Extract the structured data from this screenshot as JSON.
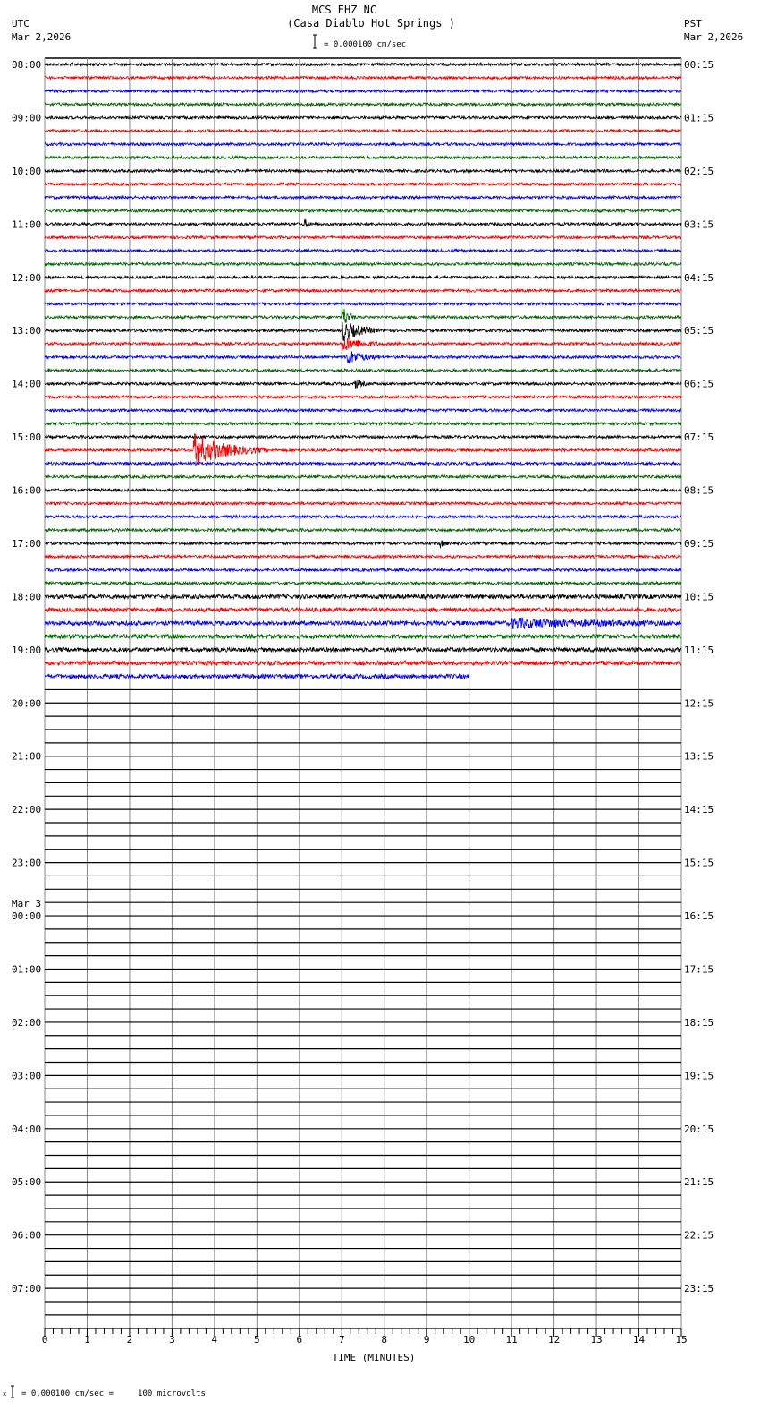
{
  "header": {
    "title": "MCS EHZ NC",
    "subtitle": "(Casa Diablo Hot Springs )",
    "left_tz": "UTC",
    "left_date": "Mar 2,2026",
    "right_tz": "PST",
    "right_date": "Mar 2,2026",
    "scale_text": "= 0.000100 cm/sec"
  },
  "footer": {
    "scale_prefix": "x",
    "scale_text": "= 0.000100 cm/sec =     100 microvolts"
  },
  "chart_data": {
    "type": "line",
    "title": "MCS EHZ NC (Casa Diablo Hot Springs )",
    "xlabel": "TIME (MINUTES)",
    "xlim": [
      0,
      15
    ],
    "xticks": [
      "0",
      "1",
      "2",
      "3",
      "4",
      "5",
      "6",
      "7",
      "8",
      "9",
      "10",
      "11",
      "12",
      "13",
      "14",
      "15"
    ],
    "grid": true,
    "trace_colors": [
      "#000000",
      "#ff0000",
      "#0000ff",
      "#006400"
    ],
    "traces_per_hour": 4,
    "minutes_per_trace": 15,
    "left_labels": [
      "08:00",
      "09:00",
      "10:00",
      "11:00",
      "12:00",
      "13:00",
      "14:00",
      "15:00",
      "16:00",
      "17:00",
      "18:00",
      "19:00",
      "20:00",
      "21:00",
      "22:00",
      "23:00",
      "00:00",
      "01:00",
      "02:00",
      "03:00",
      "04:00",
      "05:00",
      "06:00",
      "07:00"
    ],
    "left_date_change": {
      "label": "Mar 3",
      "at_hour_index": 16
    },
    "right_labels": [
      "00:15",
      "01:15",
      "02:15",
      "03:15",
      "04:15",
      "05:15",
      "06:15",
      "07:15",
      "08:15",
      "09:15",
      "10:15",
      "11:15",
      "12:15",
      "13:15",
      "14:15",
      "15:15",
      "16:15",
      "17:15",
      "18:15",
      "19:15",
      "20:15",
      "21:15",
      "22:15",
      "23:15"
    ],
    "total_lines": 96,
    "recorded_full_traces": 46,
    "last_trace_minutes": 10,
    "events": [
      {
        "trace_index": 12,
        "minute_start": 6.1,
        "minute_end": 6.3,
        "amplitude": 2
      },
      {
        "trace_index": 19,
        "minute_start": 7.0,
        "minute_end": 7.3,
        "amplitude": 5
      },
      {
        "trace_index": 20,
        "minute_start": 7.0,
        "minute_end": 7.9,
        "amplitude": 4
      },
      {
        "trace_index": 21,
        "minute_start": 7.0,
        "minute_end": 7.9,
        "amplitude": 3
      },
      {
        "trace_index": 22,
        "minute_start": 7.1,
        "minute_end": 7.9,
        "amplitude": 3
      },
      {
        "trace_index": 24,
        "minute_start": 7.3,
        "minute_end": 7.6,
        "amplitude": 2
      },
      {
        "trace_index": 29,
        "minute_start": 3.5,
        "minute_end": 5.2,
        "amplitude": 6
      },
      {
        "trace_index": 36,
        "minute_start": 9.3,
        "minute_end": 9.5,
        "amplitude": 2
      },
      {
        "trace_index": 42,
        "minute_start": 11.0,
        "minute_end": 15.0,
        "amplitude": 1.6
      }
    ]
  }
}
